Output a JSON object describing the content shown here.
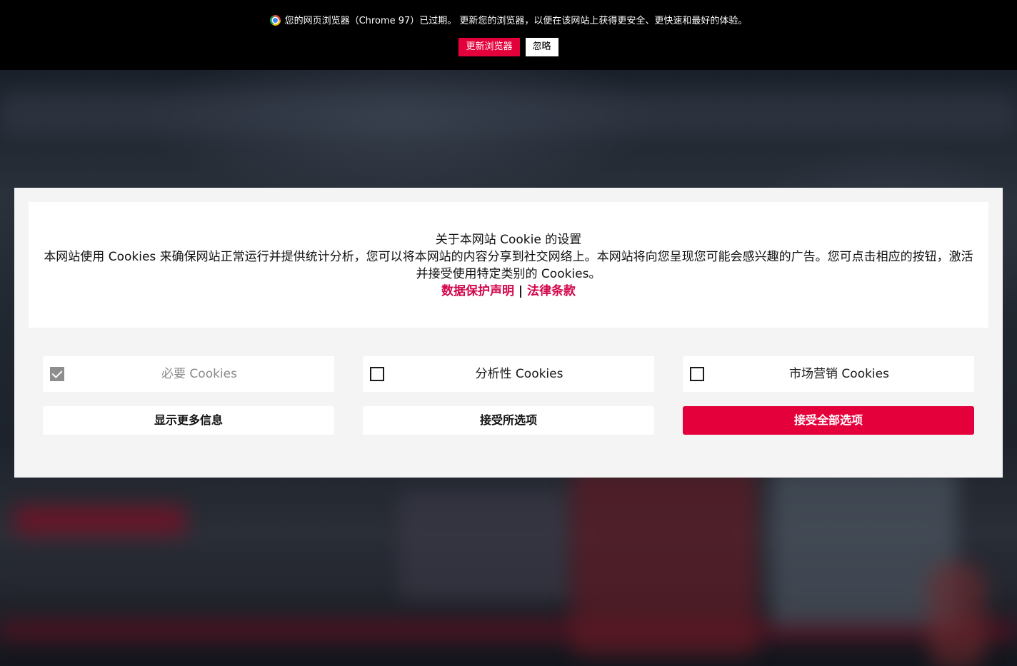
{
  "update_bar": {
    "message": "您的网页浏览器（Chrome 97）已过期。 更新您的浏览器，以便在该网站上获得更安全、更快速和最好的体验。",
    "update_label": "更新浏览器",
    "ignore_label": "忽略",
    "icon": "chrome-icon"
  },
  "cookie_dialog": {
    "title": "关于本网站 Cookie 的设置",
    "body": "本网站使用 Cookies 来确保网站正常运行并提供统计分析，您可以将本网站的内容分享到社交网络上。本网站将向您呈现您可能会感兴趣的广告。您可点击相应的按钮，激活并接受使用特定类别的 Cookies。",
    "links": {
      "privacy": "数据保护声明",
      "separator": "|",
      "legal": "法律条款"
    },
    "options": {
      "necessary": {
        "label": "必要 Cookies",
        "checked": true,
        "disabled": true
      },
      "analytics": {
        "label": "分析性 Cookies",
        "checked": false
      },
      "marketing": {
        "label": "市场营销 Cookies",
        "checked": false
      }
    },
    "buttons": {
      "more_info": "显示更多信息",
      "accept_selected": "接受所选项",
      "accept_all": "接受全部选项"
    }
  },
  "colors": {
    "accent": "#e4003a",
    "link": "#d1064a",
    "dialog_bg": "#f4f4f5",
    "bar_bg": "#000000"
  }
}
